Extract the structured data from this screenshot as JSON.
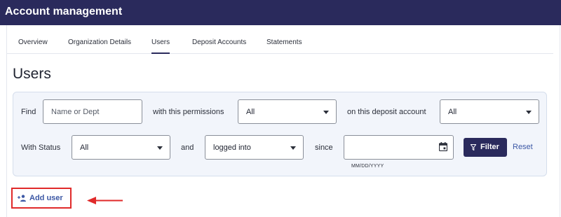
{
  "app": {
    "title": "Account management"
  },
  "tabs": [
    {
      "label": "Overview",
      "active": false
    },
    {
      "label": "Organization Details",
      "active": false
    },
    {
      "label": "Users",
      "active": true
    },
    {
      "label": "Deposit Accounts",
      "active": false
    },
    {
      "label": "Statements",
      "active": false
    }
  ],
  "page": {
    "title": "Users"
  },
  "filters": {
    "find_label": "Find",
    "name_placeholder": "Name or Dept",
    "permissions_label": "with this permissions",
    "permissions_value": "All",
    "deposit_label": "on this deposit account",
    "deposit_value": "All",
    "status_label": "With Status",
    "status_value": "All",
    "and_label": "and",
    "login_value": "logged into",
    "since_label": "since",
    "date_value": "",
    "date_hint": "MM/DD/YYYY",
    "filter_button": "Filter",
    "reset_link": "Reset"
  },
  "actions": {
    "add_user": "Add user"
  },
  "annotation": {
    "arrow_color": "#e02a2a",
    "highlight_color": "#e02a2a"
  },
  "colors": {
    "header_bg": "#2a2a5c",
    "accent": "#2a2a5c",
    "link": "#3c58a5",
    "panel_bg": "#f2f5fb"
  },
  "icons": {
    "date": "calendar-icon",
    "filter": "funnel-icon",
    "add_user": "person-add-icon",
    "dropdown": "chevron-down-icon"
  }
}
